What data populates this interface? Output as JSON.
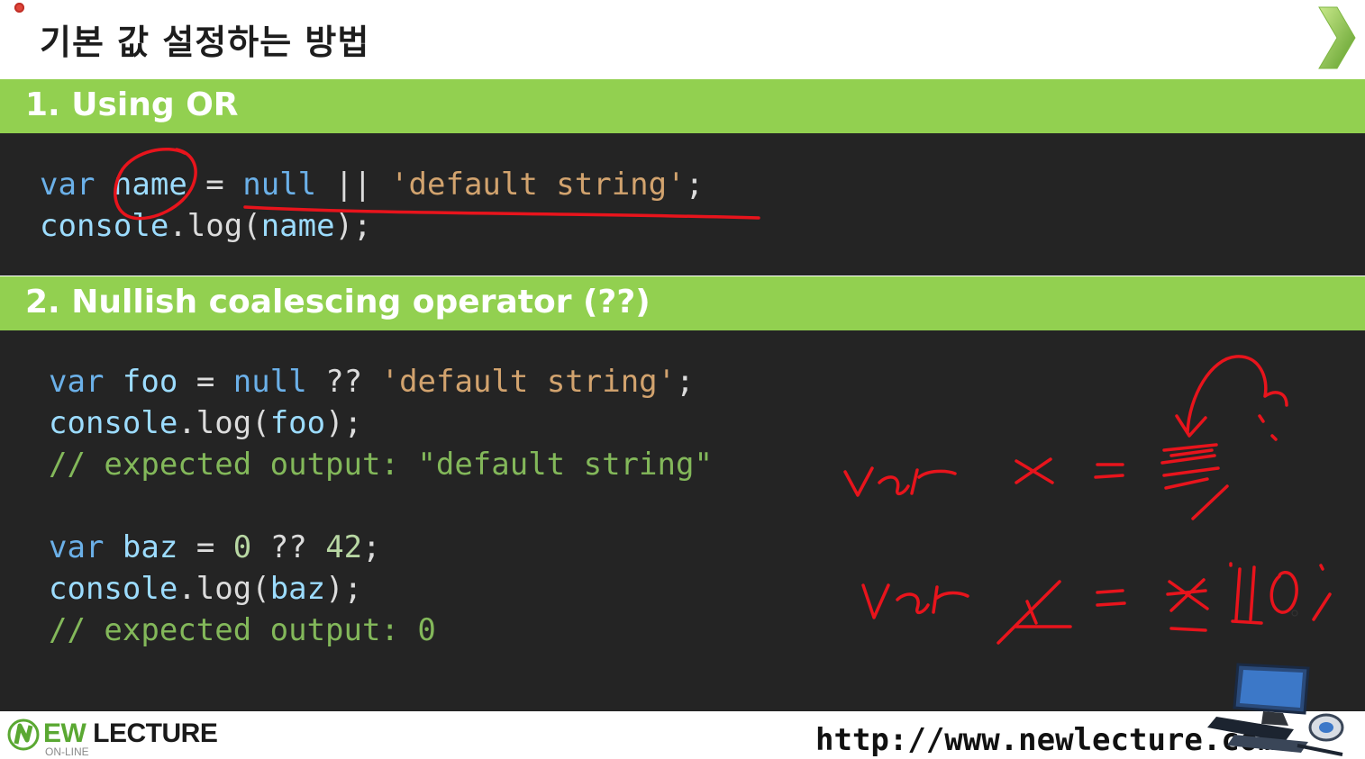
{
  "slide": {
    "title": "기본 값 설정하는 방법"
  },
  "section1": {
    "heading": "1. Using OR",
    "code": {
      "line1": {
        "kw": "var",
        "name": "name",
        "op": "=",
        "val": "null",
        "or": "||",
        "str": "'default string'",
        "end": ";"
      },
      "line2": {
        "obj": "console",
        "dot": ".",
        "fn": "log",
        "open": "(",
        "arg": "name",
        "close": ");"
      }
    }
  },
  "section2": {
    "heading": "2. Nullish coalescing operator (??)",
    "code": {
      "line1": {
        "kw": "var",
        "name": "foo",
        "op": "=",
        "val": "null",
        "nc": "??",
        "str": "'default string'",
        "end": ";"
      },
      "line2": {
        "obj": "console",
        "dot": ".",
        "fn": "log",
        "open": "(",
        "arg": "foo",
        "close": ");"
      },
      "line3": "// expected output: \"default string\"",
      "line5": {
        "kw": "var",
        "name": "baz",
        "op": "=",
        "val": "0",
        "nc": "??",
        "num": "42",
        "end": ";"
      },
      "line6": {
        "obj": "console",
        "dot": ".",
        "fn": "log",
        "open": "(",
        "arg": "baz",
        "close": ");"
      },
      "line7": "// expected output: 0"
    }
  },
  "footer": {
    "logo_brand_ew": "EW",
    "logo_brand_lecture": " LECTURE",
    "logo_sub": "ON-LINE",
    "url": "http://www.newlecture.com"
  },
  "colors": {
    "section_bar": "#92d050",
    "code_bg": "#242424",
    "annotation": "#e8141c"
  },
  "icons": [
    "next-slide-arrow-icon",
    "logo-n-icon",
    "computer-illustration"
  ]
}
